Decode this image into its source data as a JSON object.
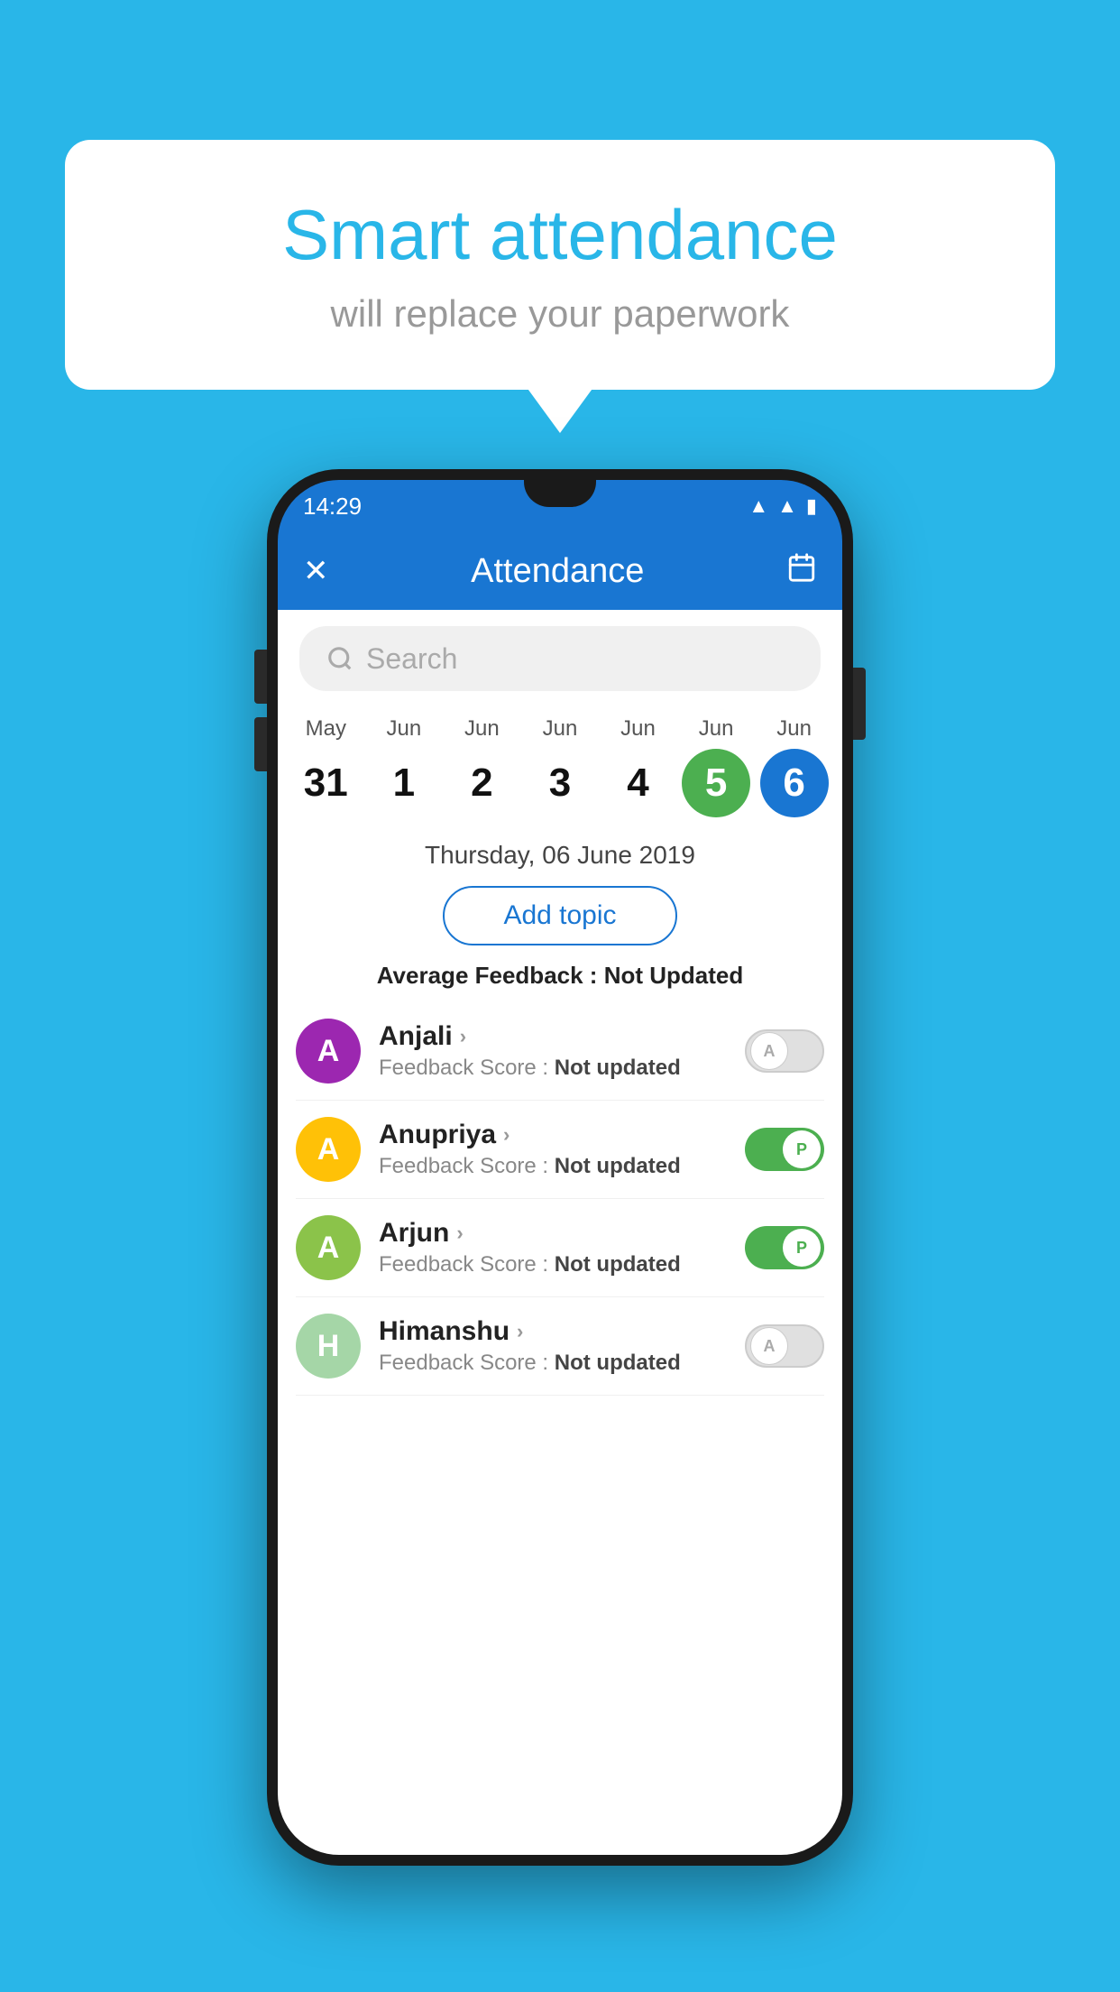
{
  "background_color": "#29B6E8",
  "speech_bubble": {
    "title": "Smart attendance",
    "subtitle": "will replace your paperwork"
  },
  "status_bar": {
    "time": "14:29",
    "icons": [
      "wifi",
      "signal",
      "battery"
    ]
  },
  "app_bar": {
    "close_icon": "✕",
    "title": "Attendance",
    "calendar_icon": "📅"
  },
  "search": {
    "placeholder": "Search"
  },
  "calendar": {
    "days": [
      {
        "month": "May",
        "date": "31",
        "active": false
      },
      {
        "month": "Jun",
        "date": "1",
        "active": false
      },
      {
        "month": "Jun",
        "date": "2",
        "active": false
      },
      {
        "month": "Jun",
        "date": "3",
        "active": false
      },
      {
        "month": "Jun",
        "date": "4",
        "active": false
      },
      {
        "month": "Jun",
        "date": "5",
        "active": "green"
      },
      {
        "month": "Jun",
        "date": "6",
        "active": "blue"
      }
    ],
    "selected_date": "Thursday, 06 June 2019"
  },
  "add_topic_label": "Add topic",
  "average_feedback": {
    "label": "Average Feedback :",
    "value": "Not Updated"
  },
  "students": [
    {
      "name": "Anjali",
      "avatar_letter": "A",
      "avatar_color": "#9C27B0",
      "feedback_label": "Feedback Score :",
      "feedback_value": "Not updated",
      "toggle": "off",
      "toggle_letter": "A"
    },
    {
      "name": "Anupriya",
      "avatar_letter": "A",
      "avatar_color": "#FFC107",
      "feedback_label": "Feedback Score :",
      "feedback_value": "Not updated",
      "toggle": "on",
      "toggle_letter": "P"
    },
    {
      "name": "Arjun",
      "avatar_letter": "A",
      "avatar_color": "#8BC34A",
      "feedback_label": "Feedback Score :",
      "feedback_value": "Not updated",
      "toggle": "on",
      "toggle_letter": "P"
    },
    {
      "name": "Himanshu",
      "avatar_letter": "H",
      "avatar_color": "#A5D6A7",
      "feedback_label": "Feedback Score :",
      "feedback_value": "Not updated",
      "toggle": "off",
      "toggle_letter": "A"
    }
  ]
}
